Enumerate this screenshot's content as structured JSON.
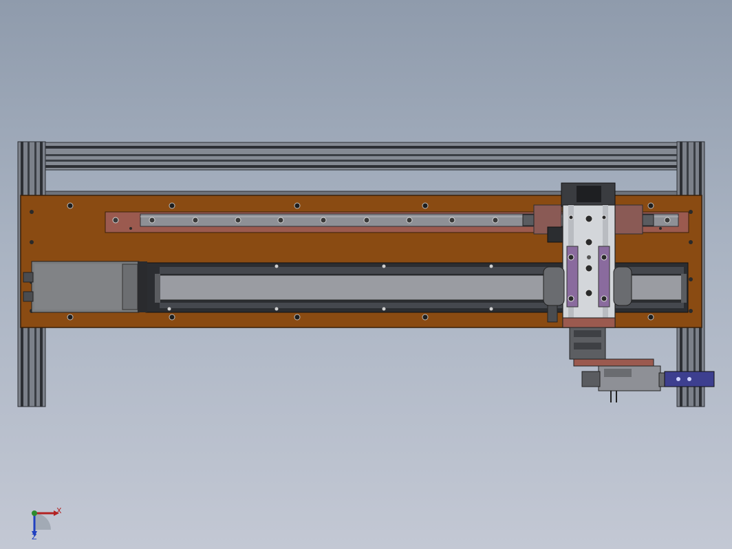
{
  "viewport": {
    "background_top": "#8f9bac",
    "background_bottom": "#c3c8d4"
  },
  "model": {
    "frame_color": "#7c818a",
    "frame_dark": "#2c2f34",
    "base_plate_color": "#8a4b12",
    "rail_plate_color": "#9b5a4f",
    "rail_color": "#8e9096",
    "motor_color": "#7a7c7e",
    "carriage_color": "#d3d6da",
    "carriage_accent": "#8a6b9e",
    "cylinder_color": "#3d3f8f"
  },
  "triad": {
    "x_label": "X",
    "z_label": "Z",
    "x_color": "#b22222",
    "y_color": "#2e8b2e",
    "z_color": "#2040c0"
  }
}
